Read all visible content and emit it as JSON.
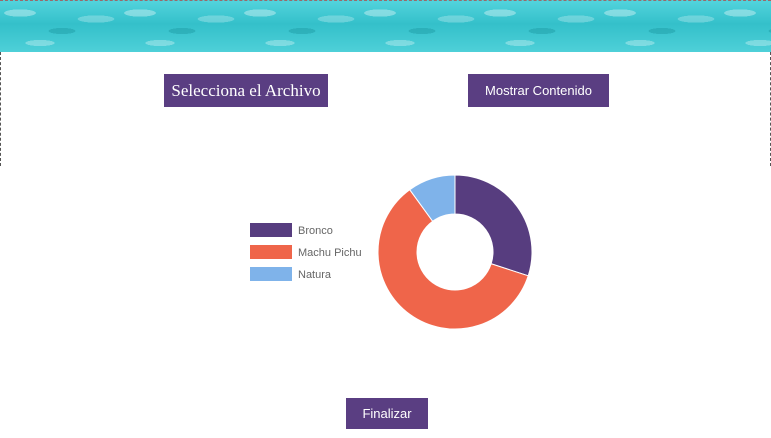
{
  "buttons": {
    "select_file": "Selecciona el Archivo",
    "show_content": "Mostrar Contenido",
    "finish": "Finalizar"
  },
  "colors": {
    "button_bg": "#5a3e82",
    "banner": "#3fc8d1"
  },
  "chart_data": {
    "type": "pie",
    "donut": true,
    "labels": [
      "Bronco",
      "Machu Pichu",
      "Natura"
    ],
    "values": [
      30,
      60,
      10
    ],
    "colors": [
      "#573d7f",
      "#ef654a",
      "#7fb3ea"
    ],
    "legend_position": "left"
  }
}
